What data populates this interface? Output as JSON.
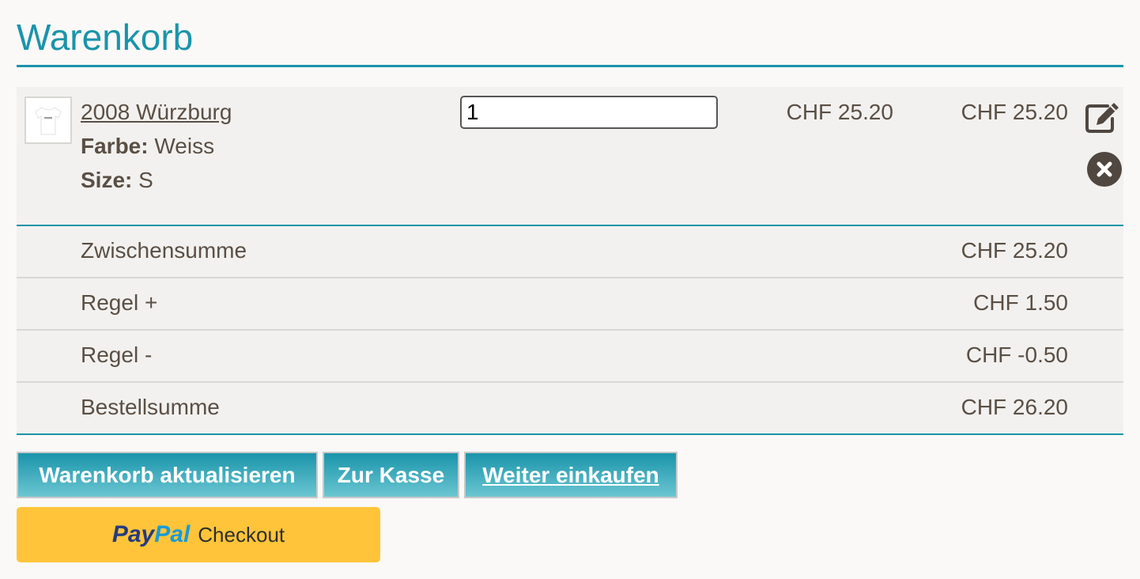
{
  "page": {
    "title": "Warenkorb"
  },
  "cart": {
    "item": {
      "name": "2008 Würzburg",
      "options": [
        {
          "label": "Farbe:",
          "value": "Weiss"
        },
        {
          "label": "Size:",
          "value": "S"
        }
      ],
      "quantity": "1",
      "unit_price": "CHF 25.20",
      "line_total": "CHF 25.20",
      "edit_icon": "edit-icon",
      "remove_icon": "remove-icon"
    },
    "totals": [
      {
        "label": "Zwischensumme",
        "value": "CHF 25.20"
      },
      {
        "label": "Regel +",
        "value": "CHF 1.50"
      },
      {
        "label": "Regel -",
        "value": "CHF -0.50"
      },
      {
        "label": "Bestellsumme",
        "value": "CHF 26.20"
      }
    ]
  },
  "actions": {
    "update_label": "Warenkorb aktualisieren",
    "checkout_label": "Zur Kasse",
    "continue_label": "Weiter einkaufen"
  },
  "paypal": {
    "brand_pay": "Pay",
    "brand_pal": "Pal",
    "label": "Checkout"
  },
  "colors": {
    "accent": "#1a94aa",
    "text": "#5a4f45",
    "paypal_yellow": "#ffc439"
  }
}
